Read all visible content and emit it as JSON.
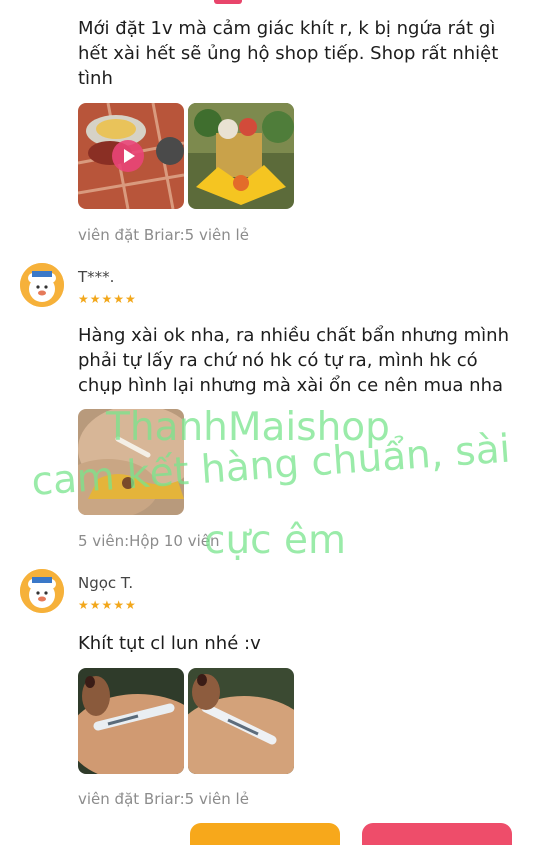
{
  "reviews": [
    {
      "text": "Mới đặt 1v mà cảm giác khít r, k bị ngứa rát gì hết xài hết sẽ ủng hộ shop tiếp. Shop rất nhiệt tình",
      "variant": "viên đặt Briar:5 viên lẻ",
      "photos": [
        "video-thumbnail",
        "product-photo"
      ]
    },
    {
      "name": "T***.",
      "rating": 5,
      "stars": "★★★★★",
      "text": "Hàng xài ok nha, ra nhiều chất bẩn nhưng mình phải tự lấy ra chứ nó hk có tự ra, mình hk có chụp hình lại nhưng mà xài ổn ce nên mua nha",
      "variant": "5 viên:Hộp 10 viên",
      "photos": [
        "product-photo"
      ]
    },
    {
      "name": "Ngọc T.",
      "rating": 5,
      "stars": "★★★★★",
      "text": "Khít tụt cl lun nhé :v",
      "variant": "viên đặt Briar:5 viên lẻ",
      "photos": [
        "product-photo",
        "product-photo"
      ]
    }
  ],
  "watermark": {
    "line1": "ThanhMaishop",
    "line2": "cam kết hàng chuẩn, sài",
    "line3": "cực êm"
  },
  "colors": {
    "accent": "#e8456b",
    "star": "#f2a71b",
    "watermark": "#78e48c",
    "avatar": "#f6b13a"
  }
}
